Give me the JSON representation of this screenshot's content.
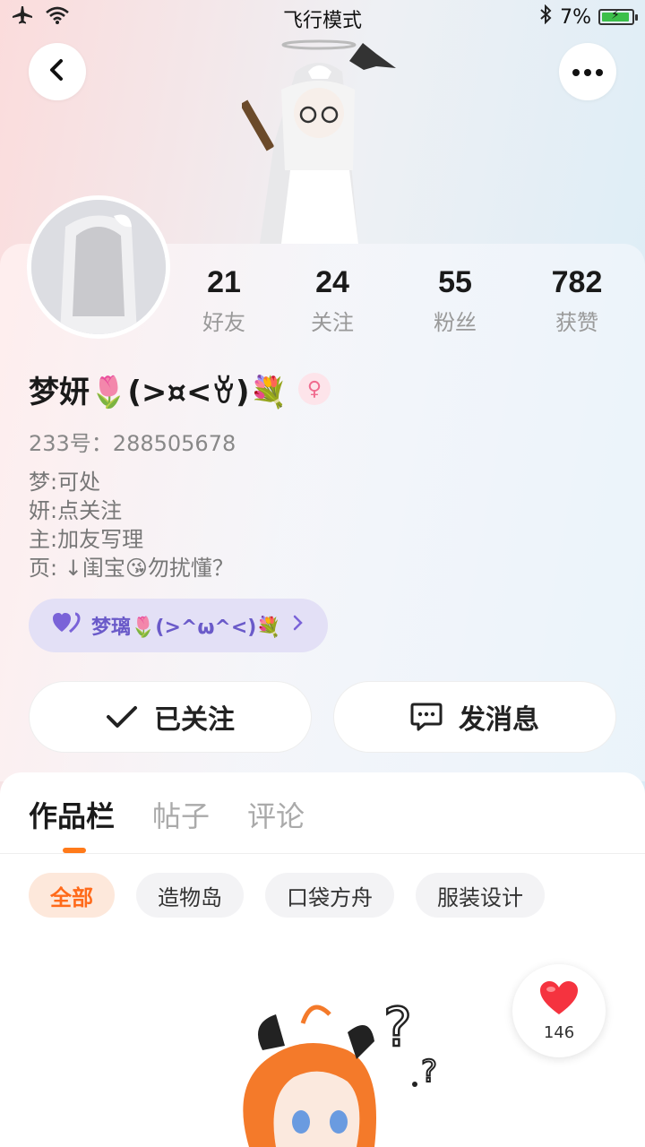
{
  "status_bar": {
    "mode": "飞行模式",
    "battery": "7%"
  },
  "stats": [
    {
      "value": "21",
      "label": "好友"
    },
    {
      "value": "24",
      "label": "关注"
    },
    {
      "value": "55",
      "label": "粉丝"
    },
    {
      "value": "782",
      "label": "获赞"
    }
  ],
  "profile": {
    "name": "梦妍🌷(>¤<ꈊ)💐",
    "gender_symbol": "♀",
    "uid": "233号：288505678",
    "bio_lines": [
      "梦:可处",
      "妍:点关注",
      "主:加友写理",
      "页: ↓闺宝😘勿扰懂？"
    ]
  },
  "relation": {
    "label": "梦璃🌷(>^ω^<)💐"
  },
  "actions": {
    "follow_label": "已关注",
    "message_label": "发消息"
  },
  "tabs": [
    "作品栏",
    "帖子",
    "评论"
  ],
  "chips": [
    "全部",
    "造物岛",
    "口袋方舟",
    "服装设计"
  ],
  "likes": {
    "count": "146"
  },
  "colors": {
    "accent": "#ff7a1a",
    "relation_text": "#6a5ac9",
    "like_red": "#f5333f"
  }
}
